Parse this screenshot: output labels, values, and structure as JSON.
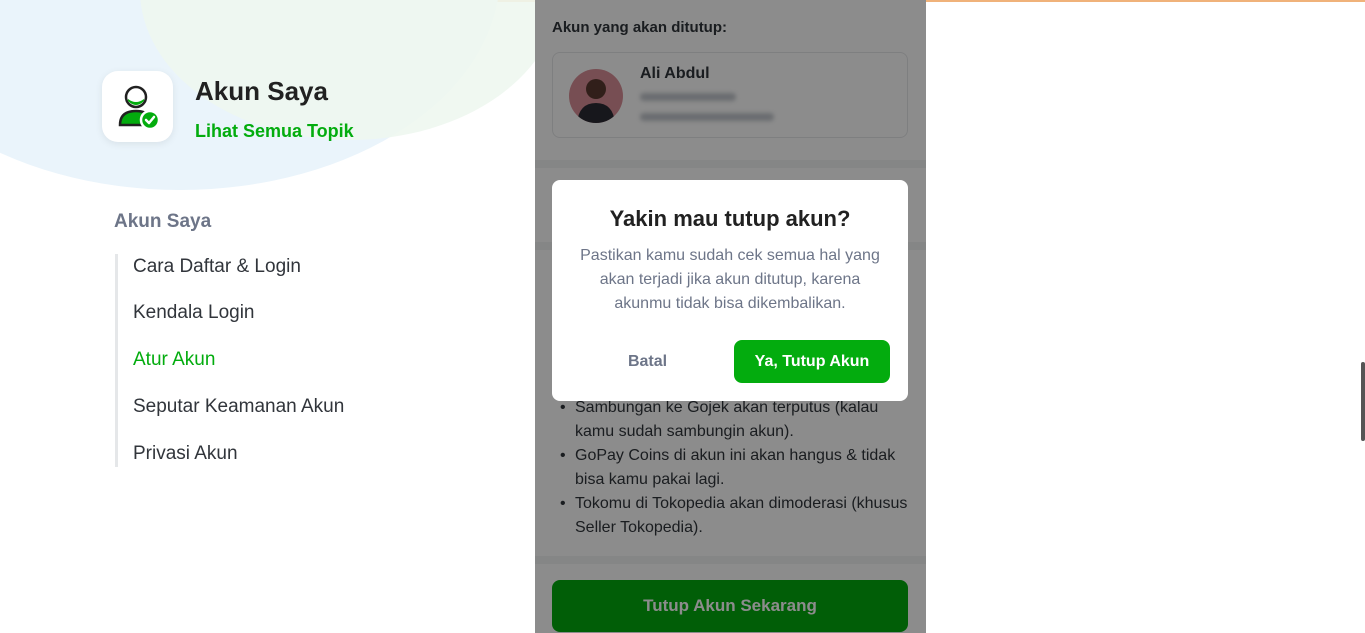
{
  "header": {
    "title": "Akun Saya",
    "link": "Lihat Semua Topik",
    "icon": "user-check-icon"
  },
  "sidebar": {
    "section_title": "Akun Saya",
    "items": [
      {
        "label": "Cara Daftar & Login",
        "active": false
      },
      {
        "label": "Kendala Login",
        "active": false
      },
      {
        "label": "Atur Akun",
        "active": true
      },
      {
        "label": "Seputar Keamanan Akun",
        "active": false
      },
      {
        "label": "Privasi Akun",
        "active": false
      }
    ]
  },
  "phone": {
    "account_label": "Akun yang akan ditutup:",
    "account_name": "Ali Abdul",
    "bullets": [
      "Sambungan ke Gojek akan terputus (kalau kamu sudah sambungin akun).",
      "GoPay Coins di akun ini akan hangus & tidak bisa kamu pakai lagi.",
      "Tokomu di Tokopedia akan dimoderasi (khusus Seller Tokopedia)."
    ],
    "bottom_button": "Tutup Akun Sekarang"
  },
  "modal": {
    "title": "Yakin mau tutup akun?",
    "body": "Pastikan kamu sudah cek semua hal yang akan terjadi jika akun ditutup, karena akunmu tidak bisa dikembalikan.",
    "cancel_label": "Batal",
    "confirm_label": "Ya, Tutup Akun"
  },
  "colors": {
    "accent": "#03ac0e",
    "muted": "#6d7588",
    "text": "#31353b"
  }
}
